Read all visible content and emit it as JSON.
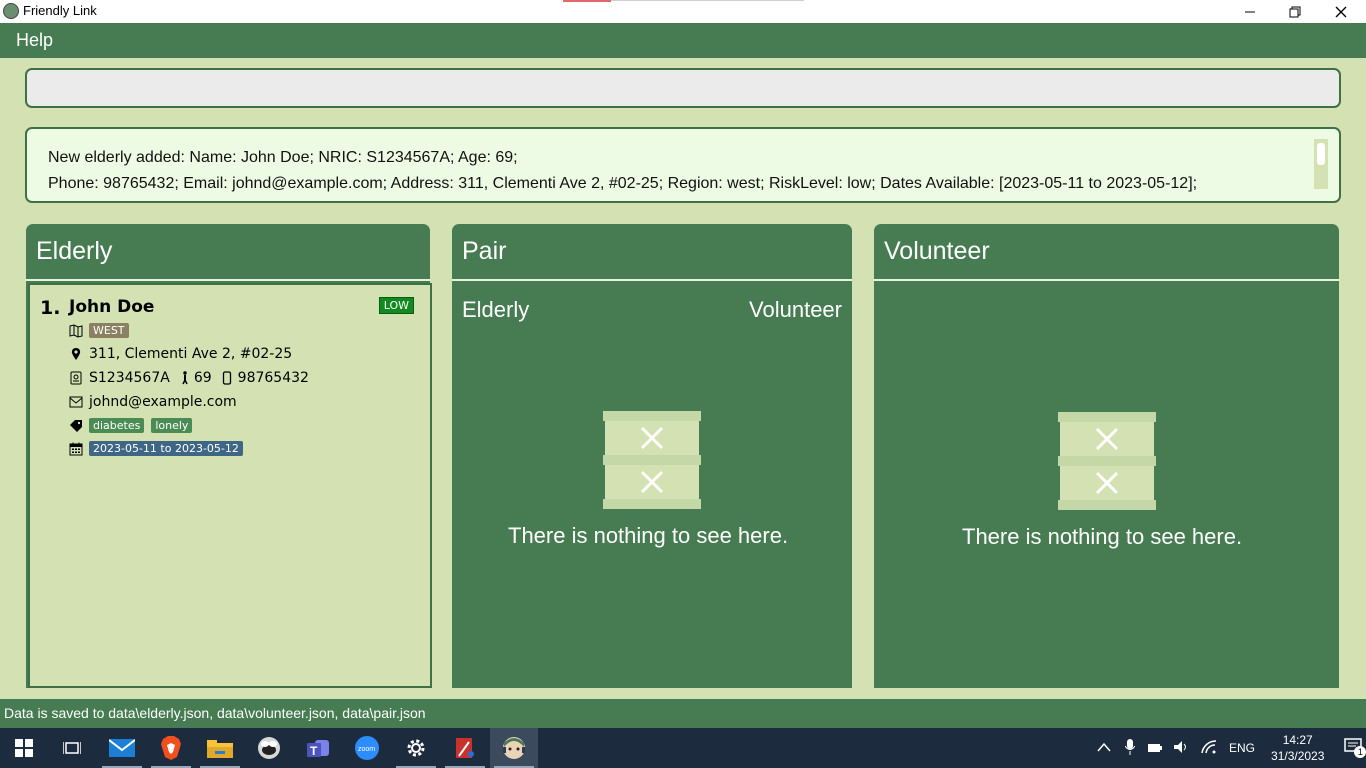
{
  "window": {
    "title": "Friendly Link"
  },
  "menu": {
    "help": "Help"
  },
  "command": {
    "value": ""
  },
  "result": {
    "line1": "New elderly added: Name: John Doe; NRIC: S1234567A; Age: 69;",
    "line2": "Phone: 98765432; Email: johnd@example.com; Address: 311, Clementi Ave 2, #02-25; Region: west; RiskLevel: low; Dates Available: [2023-05-11 to 2023-05-12];"
  },
  "elderly_panel": {
    "title": "Elderly",
    "cards": [
      {
        "index": "1.",
        "name": "John Doe",
        "risk": "LOW",
        "region": "WEST",
        "address": "311, Clementi Ave 2, #02-25",
        "nric": "S1234567A",
        "age": "69",
        "phone": "98765432",
        "email": "johnd@example.com",
        "tags": [
          "diabetes",
          "lonely"
        ],
        "dates": "2023-05-11 to 2023-05-12"
      }
    ]
  },
  "pair_panel": {
    "title": "Pair",
    "col_left": "Elderly",
    "col_right": "Volunteer",
    "empty_text": "There is nothing to see here."
  },
  "volunteer_panel": {
    "title": "Volunteer",
    "empty_text": "There is nothing to see here."
  },
  "status": {
    "text": "Data is saved to data\\elderly.json, data\\volunteer.json, data\\pair.json"
  },
  "taskbar": {
    "lang": "ENG",
    "time": "14:27",
    "date": "31/3/2023",
    "notifications": "1"
  },
  "colors": {
    "panel": "#477c52",
    "background": "#d4e2b3",
    "risk_low": "#138a1f"
  }
}
